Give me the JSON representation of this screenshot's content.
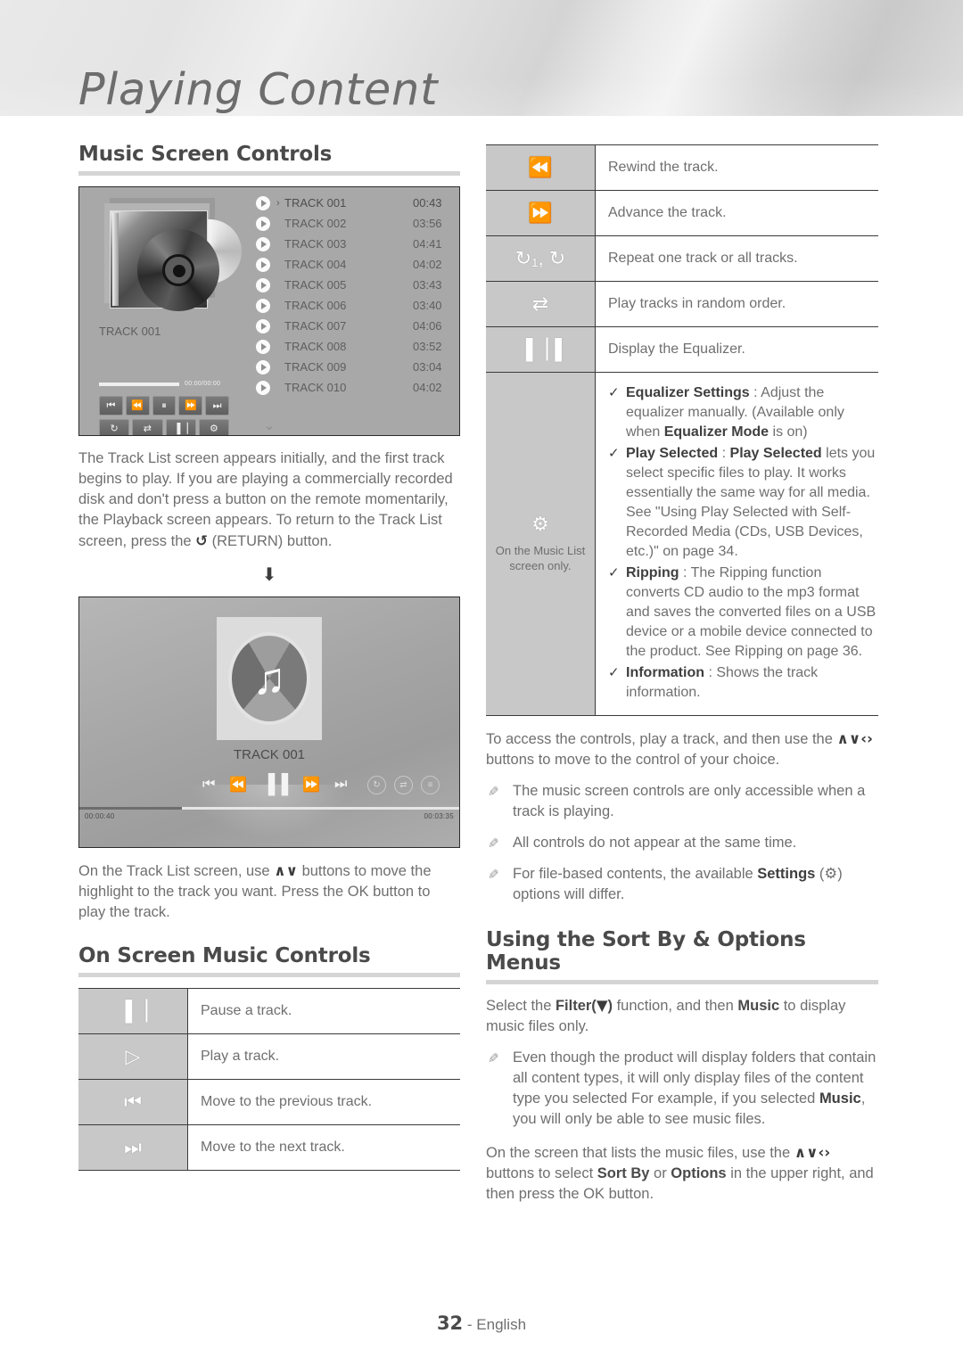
{
  "header": {
    "chapter_title": "Playing Content"
  },
  "left": {
    "section1_title": "Music Screen Controls",
    "track_screen": {
      "album_label": "TRACK 001",
      "progress_time": "00:00/00:00",
      "transport_row1": [
        "⏮",
        "⏪",
        "⏸",
        "⏩",
        "⏭"
      ],
      "transport_row2": [
        "↻",
        "⇄",
        "▐▕",
        "⚙"
      ],
      "tracks": [
        {
          "name": "TRACK 001",
          "time": "00:43",
          "current": true
        },
        {
          "name": "TRACK 002",
          "time": "03:56",
          "current": false
        },
        {
          "name": "TRACK 003",
          "time": "04:41",
          "current": false
        },
        {
          "name": "TRACK 004",
          "time": "04:02",
          "current": false
        },
        {
          "name": "TRACK 005",
          "time": "03:43",
          "current": false
        },
        {
          "name": "TRACK 006",
          "time": "03:40",
          "current": false
        },
        {
          "name": "TRACK 007",
          "time": "04:06",
          "current": false
        },
        {
          "name": "TRACK 008",
          "time": "03:52",
          "current": false
        },
        {
          "name": "TRACK 009",
          "time": "03:04",
          "current": false
        },
        {
          "name": "TRACK 010",
          "time": "04:02",
          "current": false
        }
      ],
      "scroll_more": "⌄"
    },
    "para1_a": "The Track List screen appears initially, and the first track begins to play. If you are playing a commercially recorded disk and don't press a button on the remote momentarily, the Playback screen appears. To return to the Track List screen, press the ",
    "para1_return_glyph": "↺",
    "para1_b": " (RETURN) button.",
    "arrow_down": "⬇",
    "playback_screen": {
      "title": "TRACK 001",
      "elapsed": "00:00:40",
      "total": "00:03:35",
      "controls": [
        "⏮",
        "⏪",
        "▐▐",
        "⏩",
        "⏭"
      ],
      "options": [
        "↻",
        "⇄",
        "≡"
      ]
    },
    "para2_a": "On the Track List screen, use ",
    "para2_glyph": "∧∨",
    "para2_b": " buttons to move the highlight to the track you want. Press the OK button to play the track.",
    "section2_title": "On Screen Music Controls",
    "controls_table": [
      {
        "icon": "▐▕",
        "icon_name": "pause-icon",
        "text": "Pause a track."
      },
      {
        "icon": "▷",
        "icon_name": "play-icon",
        "text": "Play a track."
      },
      {
        "icon": "⏮",
        "icon_name": "previous-track-icon",
        "text": "Move to the previous track."
      },
      {
        "icon": "⏭",
        "icon_name": "next-track-icon",
        "text": "Move to the next track."
      }
    ]
  },
  "right": {
    "controls_table": [
      {
        "icon": "⏪",
        "icon_name": "rewind-icon",
        "text": "Rewind the track."
      },
      {
        "icon": "⏩",
        "icon_name": "fast-forward-icon",
        "text": "Advance the track."
      },
      {
        "icon": "↻₁, ↻",
        "icon_name": "repeat-icon",
        "text": "Repeat one track or all tracks."
      },
      {
        "icon": "⇄",
        "icon_name": "shuffle-icon",
        "text": "Play tracks in random order."
      },
      {
        "icon": "▐▕▐",
        "icon_name": "equalizer-icon",
        "text": "Display the Equalizer."
      }
    ],
    "settings_row": {
      "icon": "⚙",
      "icon_name": "gear-icon",
      "caption": "On the Music List screen only.",
      "bullets": [
        {
          "term": "Equalizer Settings",
          "sep": " : ",
          "body_a": "Adjust the equalizer manually. (Available only when ",
          "bold_mid": "Equalizer Mode",
          "body_b": " is on)"
        },
        {
          "term": "Play Selected",
          "sep": " : ",
          "bold_lead": "Play Selected",
          "body_a": " lets you select specific files to play. It works essentially the same way for all media. See \"Using Play Selected with Self-Recorded Media (CDs, USB Devices, etc.)\" on page 34."
        },
        {
          "term": "Ripping",
          "sep": " : ",
          "body_a": "The Ripping function converts CD audio to the mp3 format and saves the converted files on a USB device or a mobile device connected to the product. See Ripping on page 36."
        },
        {
          "term": "Information",
          "sep": " : ",
          "body_a": "Shows the track information."
        }
      ]
    },
    "para3_a": "To access the controls, play a track, and then use the ",
    "para3_glyph": "∧∨‹›",
    "para3_b": " buttons to move to the control of your choice.",
    "notes": [
      {
        "text": "The music screen controls are only accessible when a track is playing."
      },
      {
        "text": "All controls do not appear at the same time."
      },
      {
        "text_a": "For file-based contents, the available ",
        "bold": "Settings",
        "text_b": " (⚙) options will differ."
      }
    ],
    "section3_title": "Using the Sort By & Options Menus",
    "para4_a": "Select the ",
    "para4_bold": "Filter(",
    "para4_glyph": "▼",
    "para4_mid": ")",
    "para4_b": " function, and then ",
    "para4_bold2": "Music",
    "para4_c": " to display music files only.",
    "note4_a": "Even though the product will display folders that contain all content types, it will only display files of the content type you selected For example, if you selected ",
    "note4_bold": "Music",
    "note4_b": ", you will only be able to see music files.",
    "para5_a": "On the screen that lists the music files, use the ",
    "para5_glyph": "∧∨‹›",
    "para5_b": " buttons to select ",
    "para5_bold1": "Sort By",
    "para5_c": " or ",
    "para5_bold2": "Options",
    "para5_d": " in the upper right, and then press the OK button."
  },
  "footer": {
    "page_number": "32",
    "separator": " - ",
    "language": "English"
  }
}
